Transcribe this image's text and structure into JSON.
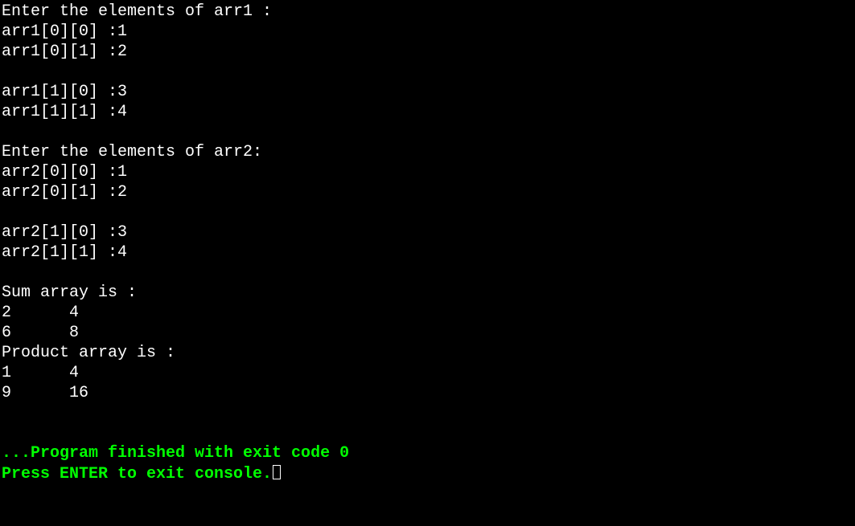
{
  "console": {
    "lines": [
      "Enter the elements of arr1 :",
      "arr1[0][0] :1",
      "arr1[0][1] :2",
      "",
      "arr1[1][0] :3",
      "arr1[1][1] :4",
      "",
      "Enter the elements of arr2:",
      "arr2[0][0] :1",
      "arr2[0][1] :2",
      "",
      "arr2[1][0] :3",
      "arr2[1][1] :4",
      "",
      "Sum array is :",
      "2      4",
      "6      8",
      "Product array is :",
      "1      4",
      "9      16",
      "",
      ""
    ],
    "exit_message": "...Program finished with exit code 0",
    "prompt_message": "Press ENTER to exit console."
  },
  "program_data": {
    "arr1": [
      [
        1,
        2
      ],
      [
        3,
        4
      ]
    ],
    "arr2": [
      [
        1,
        2
      ],
      [
        3,
        4
      ]
    ],
    "sum_array": [
      [
        2,
        4
      ],
      [
        6,
        8
      ]
    ],
    "product_array": [
      [
        1,
        4
      ],
      [
        9,
        16
      ]
    ],
    "exit_code": 0
  }
}
